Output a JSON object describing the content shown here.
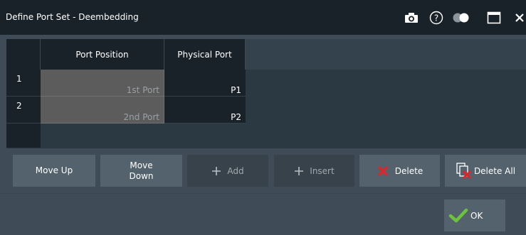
{
  "window": {
    "title": "Define Port Set - Deembedding",
    "icons": [
      "camera-icon",
      "help-icon",
      "toggle-icon",
      "maximize-icon",
      "close-icon"
    ]
  },
  "table": {
    "columns": [
      "Port Position",
      "Physical Port"
    ],
    "rows": [
      {
        "num": "1",
        "position": "1st Port",
        "physical": "P1"
      },
      {
        "num": "2",
        "position": "2nd Port",
        "physical": "P2"
      }
    ]
  },
  "buttons": {
    "move_up": "Move Up",
    "move_down": [
      "Move",
      "Down"
    ],
    "add": "Add",
    "insert": "Insert",
    "delete": "Delete",
    "delete_all": "Delete All",
    "ok": "OK"
  },
  "colors": {
    "titlebar": "#1a2229",
    "background": "#3f4c57",
    "button_enabled": "#53626d",
    "button_disabled": "#37424b",
    "delete_red": "#e0242a",
    "ok_green": "#6cc33c"
  }
}
